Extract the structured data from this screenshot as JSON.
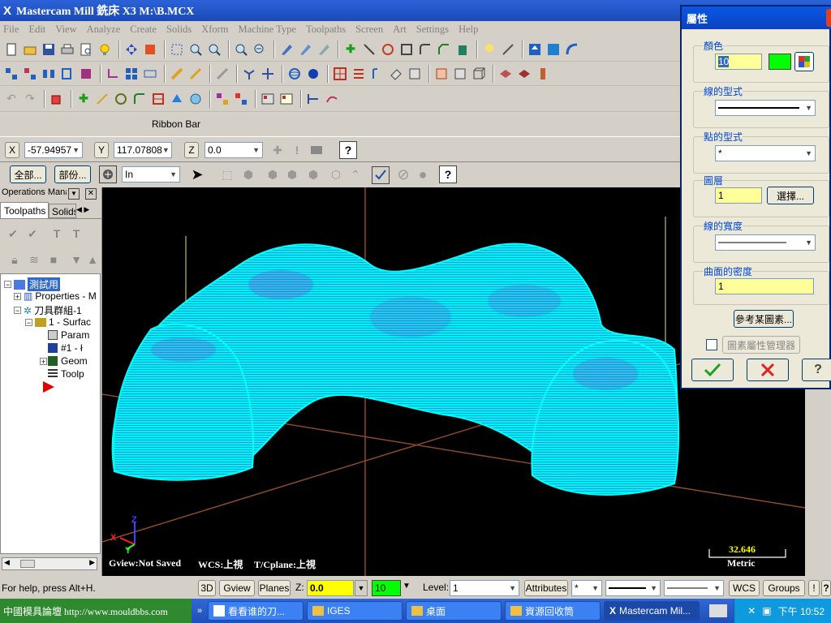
{
  "app": {
    "title": "Mastercam Mill 銑床 X3  M:\\B.MCX",
    "logo": "X"
  },
  "menu": [
    "File",
    "Edit",
    "View",
    "Analyze",
    "Create",
    "Solids",
    "Xform",
    "Machine Type",
    "Toolpaths",
    "Screen",
    "Art",
    "Settings",
    "Help"
  ],
  "ribbon_label": "Ribbon Bar",
  "coords": {
    "x_label": "X",
    "x_value": "-57.94957",
    "y_label": "Y",
    "y_value": "117.07808",
    "z_label": "Z",
    "z_value": "0.0"
  },
  "selection_bar": {
    "all_button": "全部...",
    "single_button": "部份...",
    "mode_value": "In"
  },
  "left_panel": {
    "title": "Operations Manage",
    "tabs": [
      "Toolpaths",
      "Solids"
    ],
    "tree": [
      {
        "label": "測試用",
        "indent": 0
      },
      {
        "label": "Properties - M",
        "indent": 1
      },
      {
        "label": "刀具群組-1",
        "indent": 1
      },
      {
        "label": "1 - Surfac",
        "indent": 2
      },
      {
        "label": "Param",
        "indent": 3
      },
      {
        "label": "#1 - ł",
        "indent": 3
      },
      {
        "label": "Geom",
        "indent": 3
      },
      {
        "label": "Toolp",
        "indent": 3
      }
    ]
  },
  "viewport": {
    "gview": "Gview:Not Saved",
    "wcs": "WCS:上視",
    "tcplane": "T/Cplane:上視",
    "scale_value": "32.646",
    "scale_unit": "Metric",
    "axis_z": "Z",
    "axis_x": "X",
    "axis_y": "Y"
  },
  "dialog": {
    "title": "屬性",
    "color_label": "顏色",
    "color_value": "10",
    "color_swatch": "#00ff00",
    "line_style_label": "線的型式",
    "point_style_label": "點的型式",
    "point_style_value": "*",
    "level_label": "圖層",
    "level_value": "1",
    "select_button": "選擇...",
    "line_width_label": "線的寬度",
    "surface_density_label": "曲面的密度",
    "surface_density_value": "1",
    "reference_button": "參考某圖素...",
    "manager_label": "圖素屬性管理器"
  },
  "status": {
    "help": "For help, press Alt+H.",
    "view3d": "3D",
    "gview": "Gview",
    "planes": "Planes",
    "z_label": "Z:",
    "z_value": "0.0",
    "color_value": "10",
    "level_label": "Level:",
    "level_value": "1",
    "attributes": "Attributes",
    "point_style": "*",
    "wcs": "WCS",
    "groups": "Groups",
    "excl": "!"
  },
  "taskbar": {
    "start": "中國模具論壇 http://www.mouldbbs.com",
    "tasks": [
      "看看谁的刀...",
      "IGES",
      "桌面",
      "資源回收筒",
      "Mastercam Mil..."
    ],
    "clock": "下午 10:52"
  },
  "colors": {
    "toolpath": "#00ffff",
    "toolpath_shade": "#8a55d6",
    "titlebar": "#1a48b8",
    "scale": "#ffff00"
  }
}
